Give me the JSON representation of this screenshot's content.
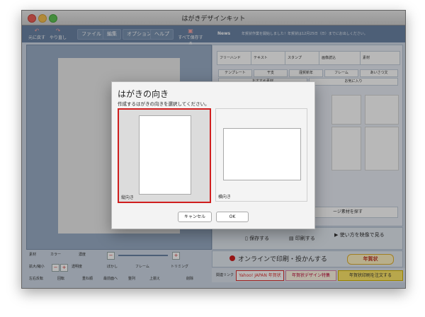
{
  "window": {
    "title": "はがきデザインキット"
  },
  "toolbar": {
    "undo": "元に戻す",
    "redo": "やり直し",
    "menus": [
      "ファイル",
      "編集",
      "オプション",
      "ヘルプ"
    ],
    "save_all": "すべて保存する"
  },
  "news": {
    "label": "News",
    "text": "年賀状作業を開始しました！年賀状は12月25日（日）までにお出しください。"
  },
  "right_tabs": [
    "フリーハンド",
    "テキスト",
    "スタンプ",
    "画像読込",
    "素材"
  ],
  "sub_tabs": [
    "テンプレート",
    "干支",
    "謹賀新年",
    "フレーム",
    "あいさつ文"
  ],
  "sub_tabs2": [
    "おすすめ素材",
    "お気に入り"
  ],
  "material_button": "ージ素材を探す",
  "save_bar": {
    "save": "保存する",
    "print": "印刷する",
    "howto": "使い方を映像で見る"
  },
  "print_bar": {
    "label": "オンラインで印刷・投かんする",
    "badge": "年賀状"
  },
  "ad_bar": {
    "label": "関連リンク",
    "ad1": "Yahoo! JAPAN 年賀状",
    "ad2": "年賀状デザイン特集",
    "ad3": "年賀状印刷を注文する"
  },
  "controls": {
    "row1": [
      "素材",
      "カラー",
      "濃度"
    ],
    "row2": [
      "拡大/縮小",
      "透明度",
      "ぼかし",
      "フレーム",
      "トリミング"
    ],
    "row3": [
      "左右反転",
      "回転",
      "重ね順",
      "最前面へ",
      "整列",
      "上揃え",
      "削除"
    ]
  },
  "dialog": {
    "title": "はがきの向き",
    "subtitle": "作成するはがきの向きを選択してください。",
    "portrait_label": "縦向き",
    "landscape_label": "横向き",
    "cancel": "キャンセル",
    "ok": "OK"
  },
  "colors": {
    "selected_border": "#d01e1e",
    "toolbar": "#6b84a5"
  }
}
